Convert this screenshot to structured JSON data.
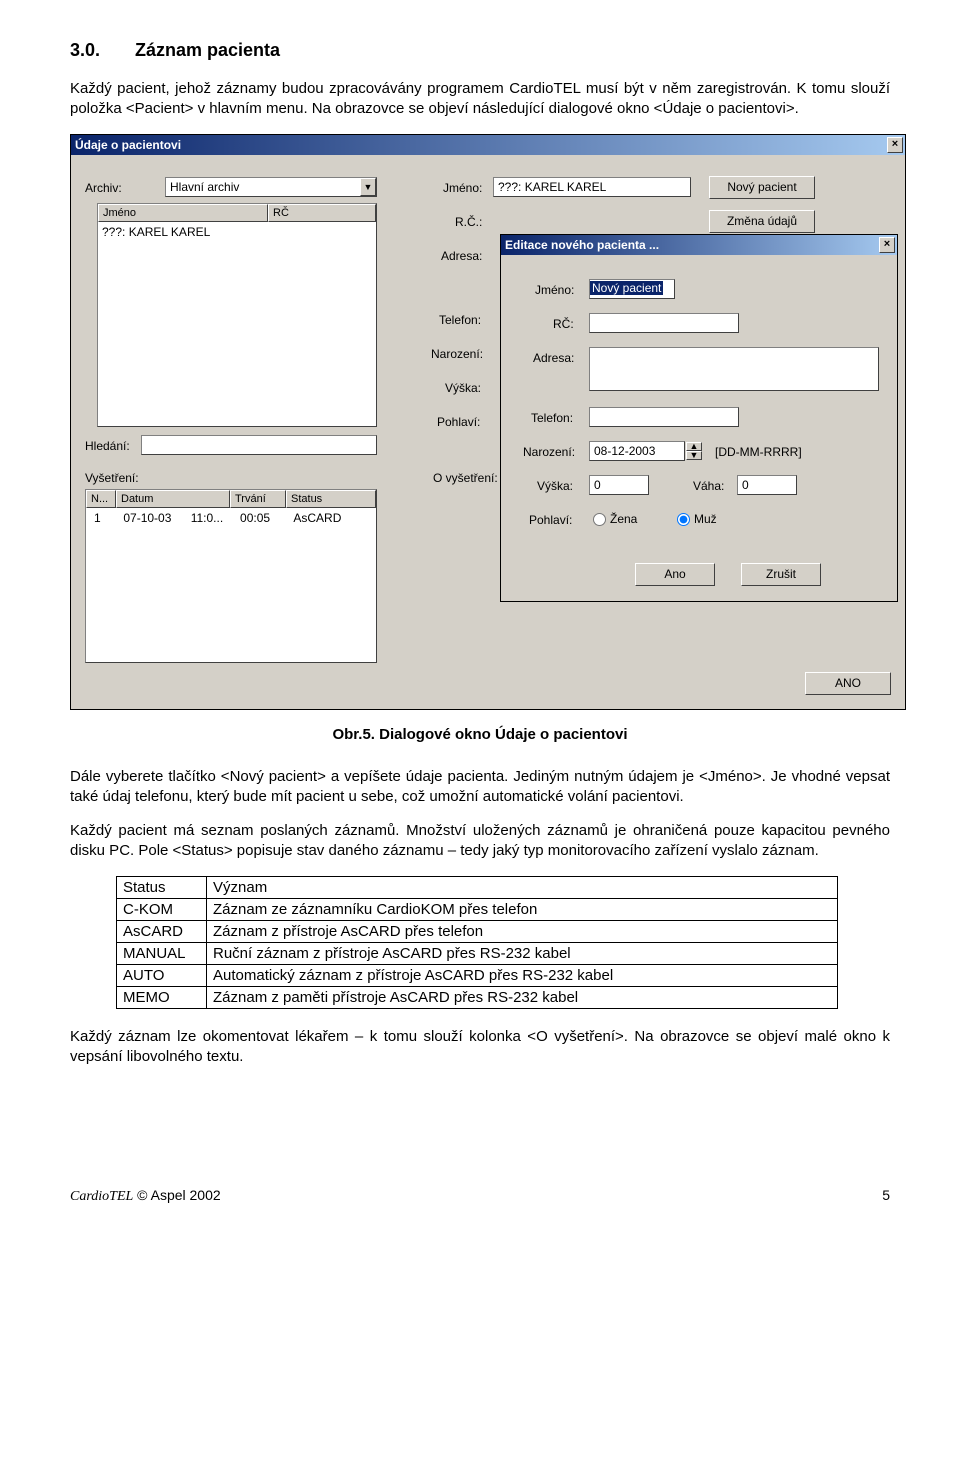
{
  "doc": {
    "section_num": "3.0.",
    "section_title": "Záznam pacienta",
    "para1": "Každý pacient, jehož záznamy budou zpracovávány programem CardioTEL musí být v něm zaregistrován. K tomu slouží položka <Pacient> v hlavním menu. Na obrazovce se objeví následující dialogové okno <Údaje o pacientovi>.",
    "caption": "Obr.5. Dialogové okno Údaje o pacientovi",
    "para2": "Dále vyberete tlačítko <Nový pacient> a vepíšete údaje pacienta. Jediným nutným údajem je <Jméno>. Je vhodné vepsat také údaj telefonu, který bude mít pacient u sebe, což umožní automatické volání pacientovi.",
    "para3": "Každý pacient má seznam poslaných záznamů. Množství uložených záznamů je ohraničená pouze kapacitou pevného disku PC. Pole <Status> popisuje stav daného záznamu – tedy jaký typ monitorovacího zařízení vyslalo záznam.",
    "para4": "Každý záznam lze okomentovat lékařem – k tomu slouží kolonka <O vyšetření>. Na obrazovce se objeví malé okno k vepsání libovolného textu.",
    "status_table": {
      "header": [
        "Status",
        "Význam"
      ],
      "rows": [
        [
          "C-KOM",
          "Záznam ze záznamníku CardioKOM přes telefon"
        ],
        [
          "AsCARD",
          "Záznam z přístroje AsCARD přes telefon"
        ],
        [
          "MANUAL",
          "Ruční záznam z přístroje AsCARD přes RS-232 kabel"
        ],
        [
          "AUTO",
          "Automatický záznam z přístroje AsCARD přes RS-232 kabel"
        ],
        [
          "MEMO",
          "Záznam z paměti přístroje AsCARD přes RS-232 kabel"
        ]
      ]
    },
    "footer_brand": "CardioTEL",
    "footer_copy": "© Aspel 2002",
    "page_num": "5"
  },
  "main": {
    "title": "Údaje o pacientovi",
    "archiv_lbl": "Archiv:",
    "archiv_val": "Hlavní archiv",
    "jmeno_lbl": "Jméno:",
    "jmeno_val": "???: KAREL KAREL",
    "rc_lbl": "R.Č.:",
    "adresa_lbl": "Adresa:",
    "telefon_lbl": "Telefon:",
    "narozeni_lbl": "Narození:",
    "vyska_lbl": "Výška:",
    "pohlavi_lbl": "Pohlaví:",
    "hledani_lbl": "Hledání:",
    "vysetreni_lbl": "Vyšetření:",
    "ovysetreni_lbl": "O vyšetření:",
    "btn_novy": "Nový pacient",
    "btn_zmena": "Změna údajů",
    "btn_ano": "ANO",
    "list": {
      "col_jmeno": "Jméno",
      "col_rc": "RČ",
      "row1": "???: KAREL KAREL"
    },
    "exam": {
      "col_n": "N...",
      "col_datum": "Datum",
      "col_trvani": "Trvání",
      "col_status": "Status",
      "r1_n": "1",
      "r1_datum": "07-10-03",
      "r1_time": "11:0...",
      "r1_trvani": "00:05",
      "r1_status": "AsCARD"
    }
  },
  "edit": {
    "title": "Editace nového pacienta ...",
    "jmeno_lbl": "Jméno:",
    "jmeno_val": "Nový pacient",
    "rc_lbl": "RČ:",
    "adresa_lbl": "Adresa:",
    "telefon_lbl": "Telefon:",
    "narozeni_lbl": "Narození:",
    "narozeni_val": "08-12-2003",
    "narozeni_fmt": "[DD-MM-RRRR]",
    "vyska_lbl": "Výška:",
    "vyska_val": "0",
    "vaha_lbl": "Váha:",
    "vaha_val": "0",
    "pohlavi_lbl": "Pohlaví:",
    "zena": "Žena",
    "muz": "Muž",
    "btn_ano": "Ano",
    "btn_zrusit": "Zrušit"
  }
}
